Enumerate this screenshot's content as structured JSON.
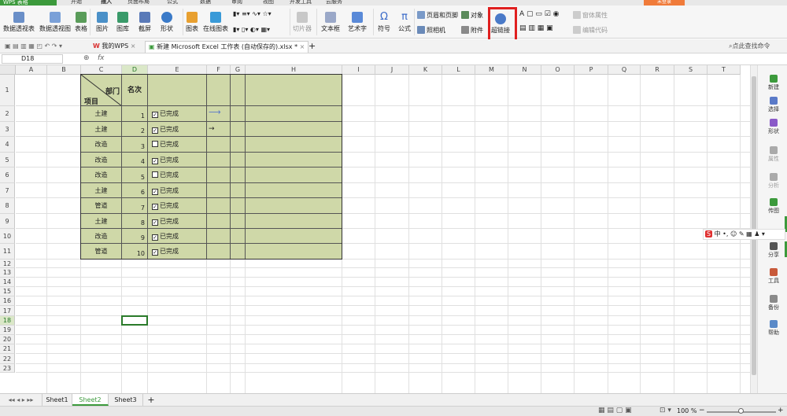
{
  "app": {
    "logo": "WPS 表格",
    "menu": [
      "开始",
      "插入",
      "页面布局",
      "公式",
      "数据",
      "审阅",
      "视图",
      "开发工具",
      "云服务"
    ],
    "active_menu": "插入",
    "login": "未登录"
  },
  "ribbon": {
    "pivot_table": "数据透视表",
    "pivot_chart": "数据透视图",
    "table": "表格",
    "picture": "图片",
    "library": "图库",
    "screenshot": "截屏",
    "shapes": "形状",
    "chart": "图表",
    "online_chart": "在线图表",
    "slicer": "切片器",
    "textbox": "文本框",
    "wordart": "艺术字",
    "symbol": "符号",
    "formula": "公式",
    "header_footer": "页眉和页脚",
    "object": "对象",
    "camera": "照相机",
    "attachment": "附件",
    "hyperlink": "超链接",
    "control_props": "窗体属性",
    "edit_code": "编辑代码"
  },
  "tabs": {
    "my_wps": "我的WPS",
    "doc": "新建 Microsoft Excel 工作表 (自动保存的).xlsx *",
    "search": "点此查找命令"
  },
  "formula_bar": {
    "cell_ref": "D18",
    "fx": "fx"
  },
  "columns": [
    "A",
    "B",
    "C",
    "D",
    "E",
    "F",
    "G",
    "H",
    "I",
    "J",
    "K",
    "L",
    "M",
    "N",
    "O",
    "P",
    "Q",
    "R",
    "S",
    "T"
  ],
  "rows": [
    "1",
    "2",
    "3",
    "4",
    "5",
    "6",
    "7",
    "8",
    "9",
    "10",
    "11",
    "12",
    "13",
    "14",
    "15",
    "16",
    "17",
    "18",
    "19",
    "20",
    "21",
    "22",
    "23"
  ],
  "table": {
    "header_dept": "部门",
    "header_item": "项目",
    "header_rank": "名次",
    "rows": [
      {
        "name": "土建",
        "rank": "1",
        "checked": true,
        "status": "已完成"
      },
      {
        "name": "土建",
        "rank": "2",
        "checked": true,
        "status": "已完成"
      },
      {
        "name": "改造",
        "rank": "3",
        "checked": false,
        "status": "已完成"
      },
      {
        "name": "改造",
        "rank": "4",
        "checked": true,
        "status": "已完成"
      },
      {
        "name": "改造",
        "rank": "5",
        "checked": false,
        "status": "已完成"
      },
      {
        "name": "土建",
        "rank": "6",
        "checked": true,
        "status": "已完成"
      },
      {
        "name": "管道",
        "rank": "7",
        "checked": true,
        "status": "已完成"
      },
      {
        "name": "土建",
        "rank": "8",
        "checked": true,
        "status": "已完成"
      },
      {
        "name": "改造",
        "rank": "9",
        "checked": true,
        "status": "已完成"
      },
      {
        "name": "管道",
        "rank": "10",
        "checked": true,
        "status": "已完成"
      }
    ]
  },
  "right_panel": [
    "新建",
    "选择",
    "形状",
    "属性",
    "分析",
    "传图",
    "分享",
    "工具",
    "备份",
    "帮助"
  ],
  "sheets": [
    "Sheet1",
    "Sheet2",
    "Sheet3"
  ],
  "active_sheet": "Sheet2",
  "status": {
    "zoom": "100 %"
  },
  "colors": {
    "accent": "#3c9a3c",
    "table_bg": "#cfd8a8",
    "highlight": "#e02020",
    "login": "#f07b3a"
  }
}
